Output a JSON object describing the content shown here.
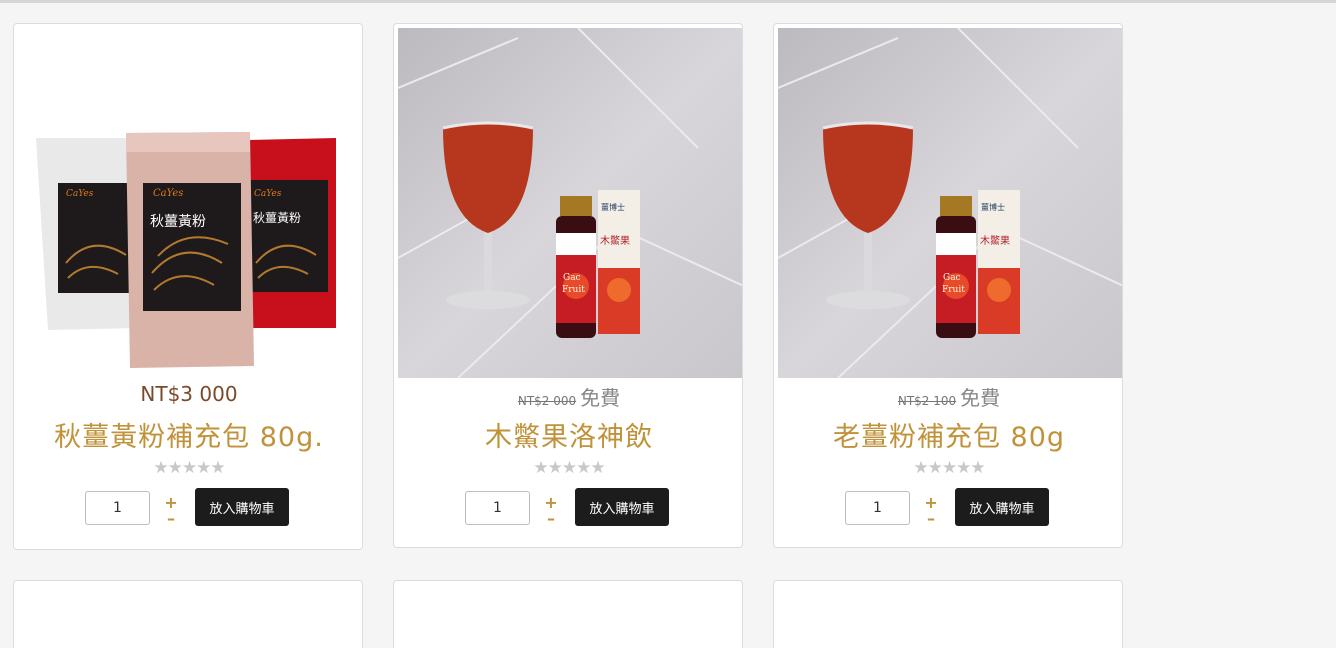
{
  "products": [
    {
      "price": "NT$3 000",
      "title": "秋薑黃粉補充包 80g.",
      "stars": "★★★★★",
      "qty": "1",
      "plus": "+",
      "minus": "–",
      "cart_label": "放入購物車",
      "pack_brand": "CaYes",
      "pack_label": "秋薑黃粉"
    },
    {
      "old_price": "NT$2 000",
      "price": "免費",
      "title": "木鱉果洛神飲",
      "stars": "★★★★★",
      "qty": "1",
      "plus": "+",
      "minus": "–",
      "cart_label": "放入購物車",
      "box_brand": "薑博士",
      "box_label": "木鱉果",
      "fruit_label_1": "Gac",
      "fruit_label_2": "Fruit"
    },
    {
      "old_price": "NT$2 100",
      "price": "免費",
      "title": "老薑粉補充包 80g",
      "stars": "★★★★★",
      "qty": "1",
      "plus": "+",
      "minus": "–",
      "cart_label": "放入購物車",
      "box_brand": "薑博士",
      "box_label": "木鱉果",
      "fruit_label_1": "Gac",
      "fruit_label_2": "Fruit"
    }
  ],
  "colors": {
    "price": "#7a4a2a",
    "title": "#c0923a",
    "button_bg": "#1c1c1c",
    "star": "#c8c8c8"
  }
}
